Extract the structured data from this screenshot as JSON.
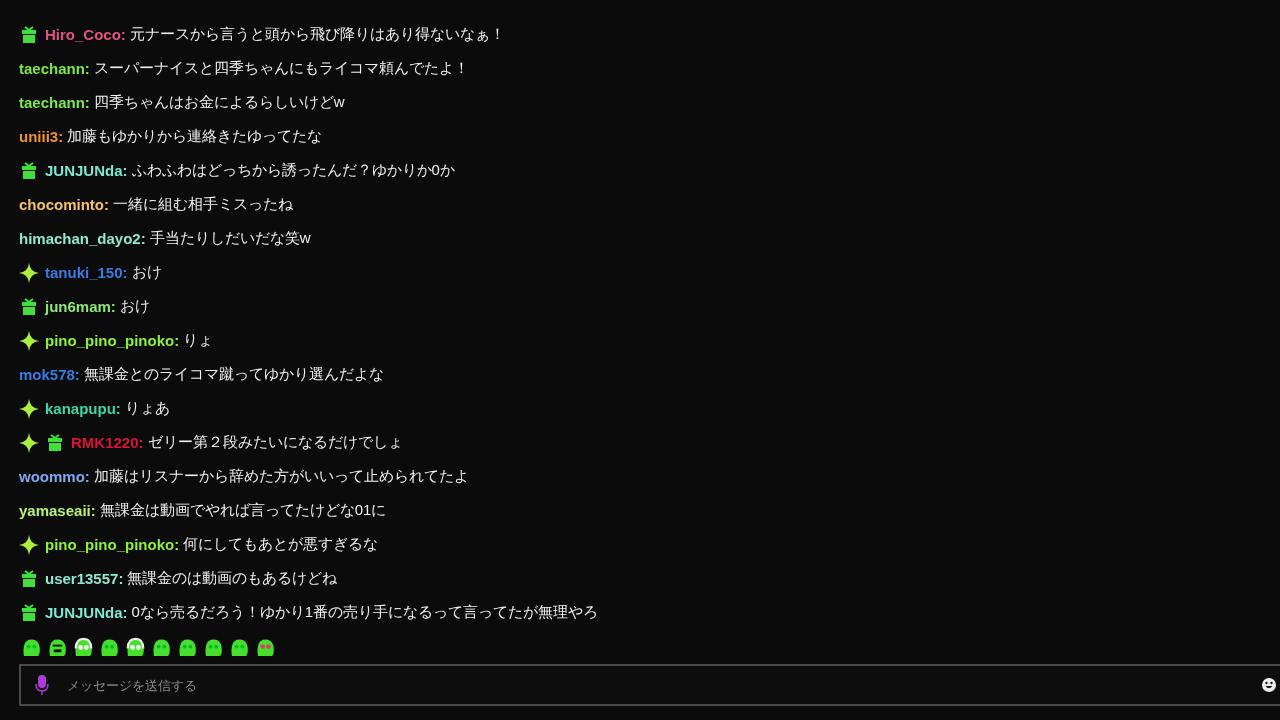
{
  "messages": [
    {
      "sparkle": false,
      "gift": true,
      "user": "Hiro_Coco:",
      "color": "#e0557f",
      "text": "元ナースから言うと頭から飛び降りはあり得ないなぁ！"
    },
    {
      "sparkle": false,
      "gift": false,
      "user": "taechann:",
      "color": "#7de84a",
      "text": "スーパーナイスと四季ちゃんにもライコマ頼んでたよ！"
    },
    {
      "sparkle": false,
      "gift": false,
      "user": "taechann:",
      "color": "#7de84a",
      "text": "四季ちゃんはお金によるらしいけどw"
    },
    {
      "sparkle": false,
      "gift": false,
      "user": "uniii3:",
      "color": "#f0922c",
      "text": "加藤もゆかりから連絡きたゆってたな"
    },
    {
      "sparkle": false,
      "gift": true,
      "user": "JUNJUNda:",
      "color": "#7fe8d0",
      "text": "ふわふわはどっちから誘ったんだ？ゆかりか0か"
    },
    {
      "sparkle": false,
      "gift": false,
      "user": "chocominto:",
      "color": "#f5c06a",
      "text": "一緒に組む相手ミスったね"
    },
    {
      "sparkle": false,
      "gift": false,
      "user": "himachan_dayo2:",
      "color": "#8fe8d0",
      "text": "手当たりしだいだな笑w"
    },
    {
      "sparkle": true,
      "gift": false,
      "user": "tanuki_150:",
      "color": "#3a7be0",
      "text": "おけ"
    },
    {
      "sparkle": false,
      "gift": true,
      "user": "jun6mam:",
      "color": "#8de87a",
      "text": "おけ"
    },
    {
      "sparkle": true,
      "gift": false,
      "user": "pino_pino_pinoko:",
      "color": "#8df03a",
      "text": "りょ"
    },
    {
      "sparkle": false,
      "gift": false,
      "user": "mok578:",
      "color": "#3a7be0",
      "text": "無課金とのライコマ蹴ってゆかり選んだよな"
    },
    {
      "sparkle": true,
      "gift": false,
      "user": "kanapupu:",
      "color": "#3dd6a5",
      "text": "りょあ"
    },
    {
      "sparkle": true,
      "gift": true,
      "user": "RMK1220:",
      "color": "#d8143a",
      "text": "ゼリー第２段みたいになるだけでしょ"
    },
    {
      "sparkle": false,
      "gift": false,
      "user": "woommo:",
      "color": "#7fa8f0",
      "text": "加藤はリスナーから辞めた方がいいって止められてたよ"
    },
    {
      "sparkle": false,
      "gift": false,
      "user": "yamaseaii:",
      "color": "#b8f07a",
      "text": "無課金は動画でやれば言ってたけどな01に"
    },
    {
      "sparkle": true,
      "gift": false,
      "user": "pino_pino_pinoko:",
      "color": "#8df03a",
      "text": "何にしてもあとが悪すぎるな"
    },
    {
      "sparkle": false,
      "gift": true,
      "user": "user13557:",
      "color": "#8fe8d0",
      "text": "無課金のは動画のもあるけどね"
    },
    {
      "sparkle": false,
      "gift": true,
      "user": "JUNJUNda:",
      "color": "#7fe8d0",
      "text": "0なら売るだろう！ゆかり1番の売り手になるって言ってたが無理やろ"
    }
  ],
  "emotes": [
    {
      "kind": "blob"
    },
    {
      "kind": "angry"
    },
    {
      "kind": "headphones"
    },
    {
      "kind": "blob"
    },
    {
      "kind": "headphones"
    },
    {
      "kind": "blob"
    },
    {
      "kind": "blob"
    },
    {
      "kind": "blob"
    },
    {
      "kind": "blob"
    },
    {
      "kind": "hearts"
    }
  ],
  "chat_input": {
    "placeholder": "メッセージを送信する"
  }
}
